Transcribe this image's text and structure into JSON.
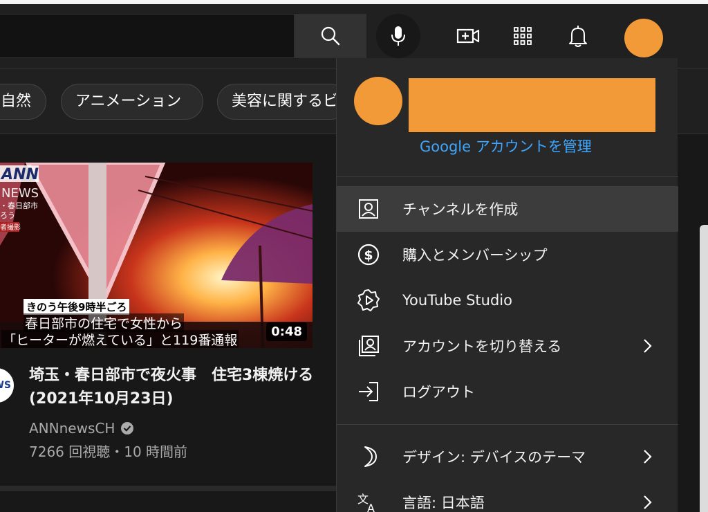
{
  "header": {
    "search_icon": "search-icon",
    "mic_icon": "mic-icon",
    "create_icon": "video-plus-icon",
    "apps_icon": "apps-grid-icon",
    "notifications_icon": "bell-icon",
    "avatar_color": "#f29a38"
  },
  "chips": [
    {
      "label": "自然"
    },
    {
      "label": "アニメーション"
    },
    {
      "label": "美容に関するビ"
    }
  ],
  "video": {
    "thumbnail_overlay": {
      "logo_line1": "ANN",
      "logo_line2": "NEWS",
      "location": "・春日部市",
      "side_line2": "ろう",
      "side_line3": "者撮影",
      "time_label": "きのう午後9時半ごろ",
      "caption_line1": "春日部市の住宅で女性から",
      "caption_line2": "「ヒーターが燃えている」と119番通報"
    },
    "duration": "0:48",
    "channel_avatar_text": "N\nWS",
    "title": "埼玉・春日部市で夜火事　住宅3棟焼ける(2021年10月23日)",
    "channel": "ANNnewsCH",
    "meta": "7266 回視聴・10 時間前"
  },
  "account_menu": {
    "manage_account": "Google アカウントを管理",
    "items": [
      {
        "label": "チャンネルを作成",
        "icon": "person-box-icon",
        "chevron": false
      },
      {
        "label": "購入とメンバーシップ",
        "icon": "dollar-circle-icon",
        "chevron": false
      },
      {
        "label": "YouTube Studio",
        "icon": "studio-gear-play-icon",
        "chevron": false
      },
      {
        "label": "アカウントを切り替える",
        "icon": "switch-account-icon",
        "chevron": true
      },
      {
        "label": "ログアウト",
        "icon": "sign-out-icon",
        "chevron": false
      },
      {
        "label": "デザイン: デバイスのテーマ",
        "icon": "moon-icon",
        "chevron": true
      },
      {
        "label": "言語: 日本語",
        "icon": "translate-icon",
        "chevron": true
      }
    ]
  },
  "colors": {
    "accent_link": "#3ea6ff",
    "avatar": "#f29a38",
    "menu_bg": "#282828",
    "hover_bg": "#3c3c3c"
  }
}
